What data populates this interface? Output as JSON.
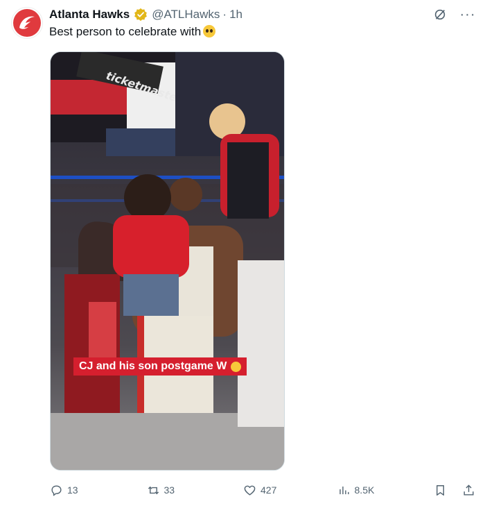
{
  "author": {
    "display_name": "Atlanta Hawks",
    "handle": "@ATLHawks",
    "separator": "·",
    "time": "1h",
    "brand_color": "#e03a3e",
    "verified_color": "#e2b719"
  },
  "tweet": {
    "text": "Best person to celebrate with"
  },
  "media": {
    "caption": "CJ and his son postgame W",
    "caption_bg": "#d51f2e",
    "arena_signage": [
      "ticketmaster"
    ]
  },
  "actions": {
    "replies": "13",
    "reposts": "33",
    "likes": "427",
    "views": "8.5K"
  },
  "icons": [
    "hawks-logo-icon",
    "verified-badge-icon",
    "grok-icon",
    "more-icon",
    "reply-icon",
    "repost-icon",
    "like-icon",
    "views-icon",
    "bookmark-icon",
    "share-icon"
  ]
}
